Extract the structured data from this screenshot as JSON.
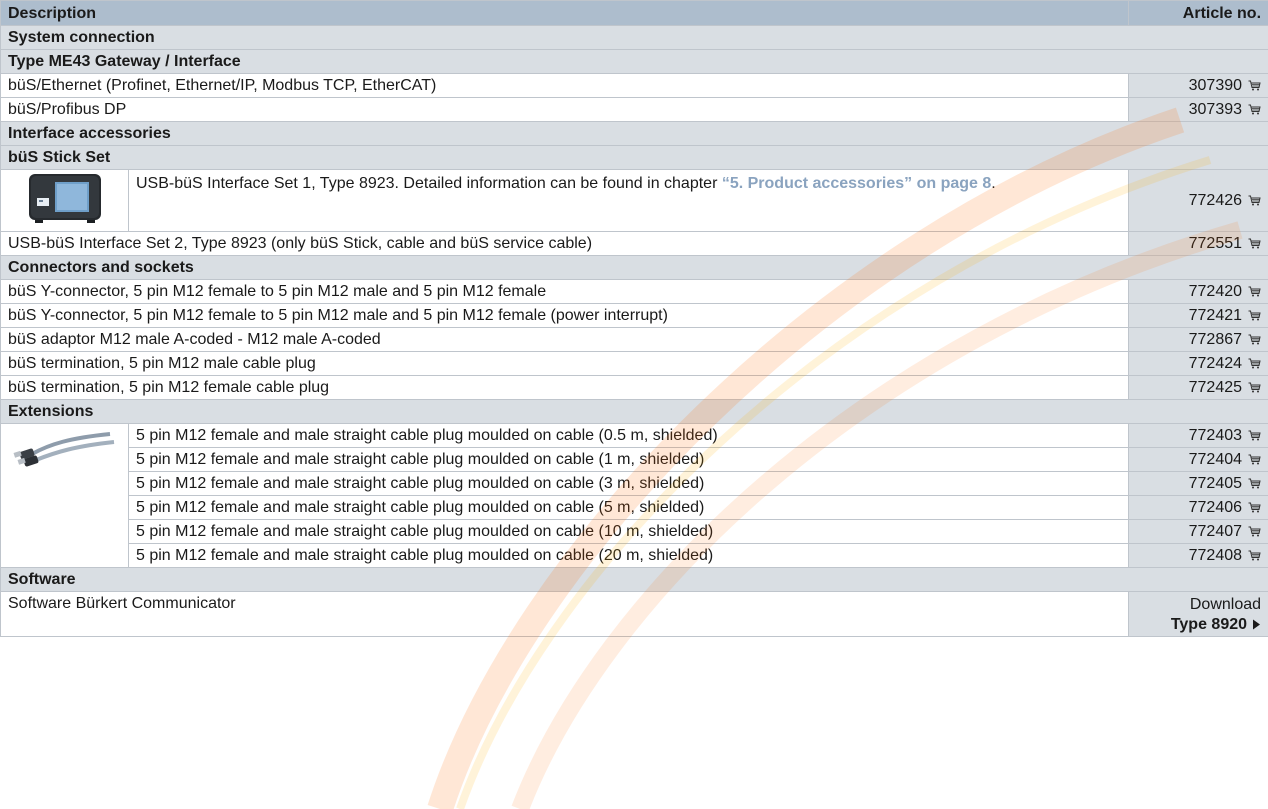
{
  "header": {
    "description": "Description",
    "article_no": "Article no."
  },
  "sections": {
    "system_connection": "System connection",
    "gateway": "Type ME43 Gateway / Interface",
    "interface_accessories": "Interface accessories",
    "stick_set": "büS Stick Set",
    "connectors": "Connectors and sockets",
    "extensions": "Extensions",
    "software": "Software"
  },
  "rows": {
    "ethernet": {
      "desc": "büS/Ethernet (Profinet, Ethernet/IP, Modbus TCP, EtherCAT)",
      "no": "307390"
    },
    "profibus": {
      "desc": "büS/Profibus DP",
      "no": "307393"
    },
    "set1": {
      "desc": "USB-büS Interface Set 1, Type 8923. Detailed information can be found in chapter ",
      "link": "“5. Product accessories” on page 8",
      "after": ".",
      "no": "772426"
    },
    "set2": {
      "desc": "USB-büS Interface Set 2, Type 8923 (only büS Stick, cable and büS service cable)",
      "no": "772551"
    },
    "yconn": {
      "desc": "büS Y-connector, 5 pin M12 female to 5 pin M12 male and 5 pin M12 female",
      "no": "772420"
    },
    "yconn_pi": {
      "desc": "büS Y-connector, 5 pin M12 female to 5 pin M12 male and 5 pin M12 female (power interrupt)",
      "no": "772421"
    },
    "adaptor": {
      "desc": "büS adaptor M12 male A-coded - M12 male A-coded",
      "no": "772867"
    },
    "term_male": {
      "desc": "büS termination, 5 pin M12 male cable plug",
      "no": "772424"
    },
    "term_female": {
      "desc": "büS termination, 5 pin M12 female cable plug",
      "no": "772425"
    },
    "ext": [
      {
        "desc": "5 pin M12 female and male straight cable plug moulded on cable (0.5 m, shielded)",
        "no": "772403"
      },
      {
        "desc": "5 pin M12 female and male straight cable plug moulded on cable (1 m, shielded)",
        "no": "772404"
      },
      {
        "desc": "5 pin M12 female and male straight cable plug moulded on cable (3 m, shielded)",
        "no": "772405"
      },
      {
        "desc": "5 pin M12 female and male straight cable plug moulded on cable (5 m, shielded)",
        "no": "772406"
      },
      {
        "desc": "5 pin M12 female and male straight cable plug moulded on cable (10 m, shielded)",
        "no": "772407"
      },
      {
        "desc": "5 pin M12 female and male straight cable plug moulded on cable (20 m, shielded)",
        "no": "772408"
      }
    ],
    "software": {
      "desc": "Software Bürkert Communicator",
      "download": "Download",
      "type": "Type 8920"
    }
  },
  "colors": {
    "header": "#adbdcd",
    "section": "#d9dee3",
    "link": "#8aa3bf"
  }
}
